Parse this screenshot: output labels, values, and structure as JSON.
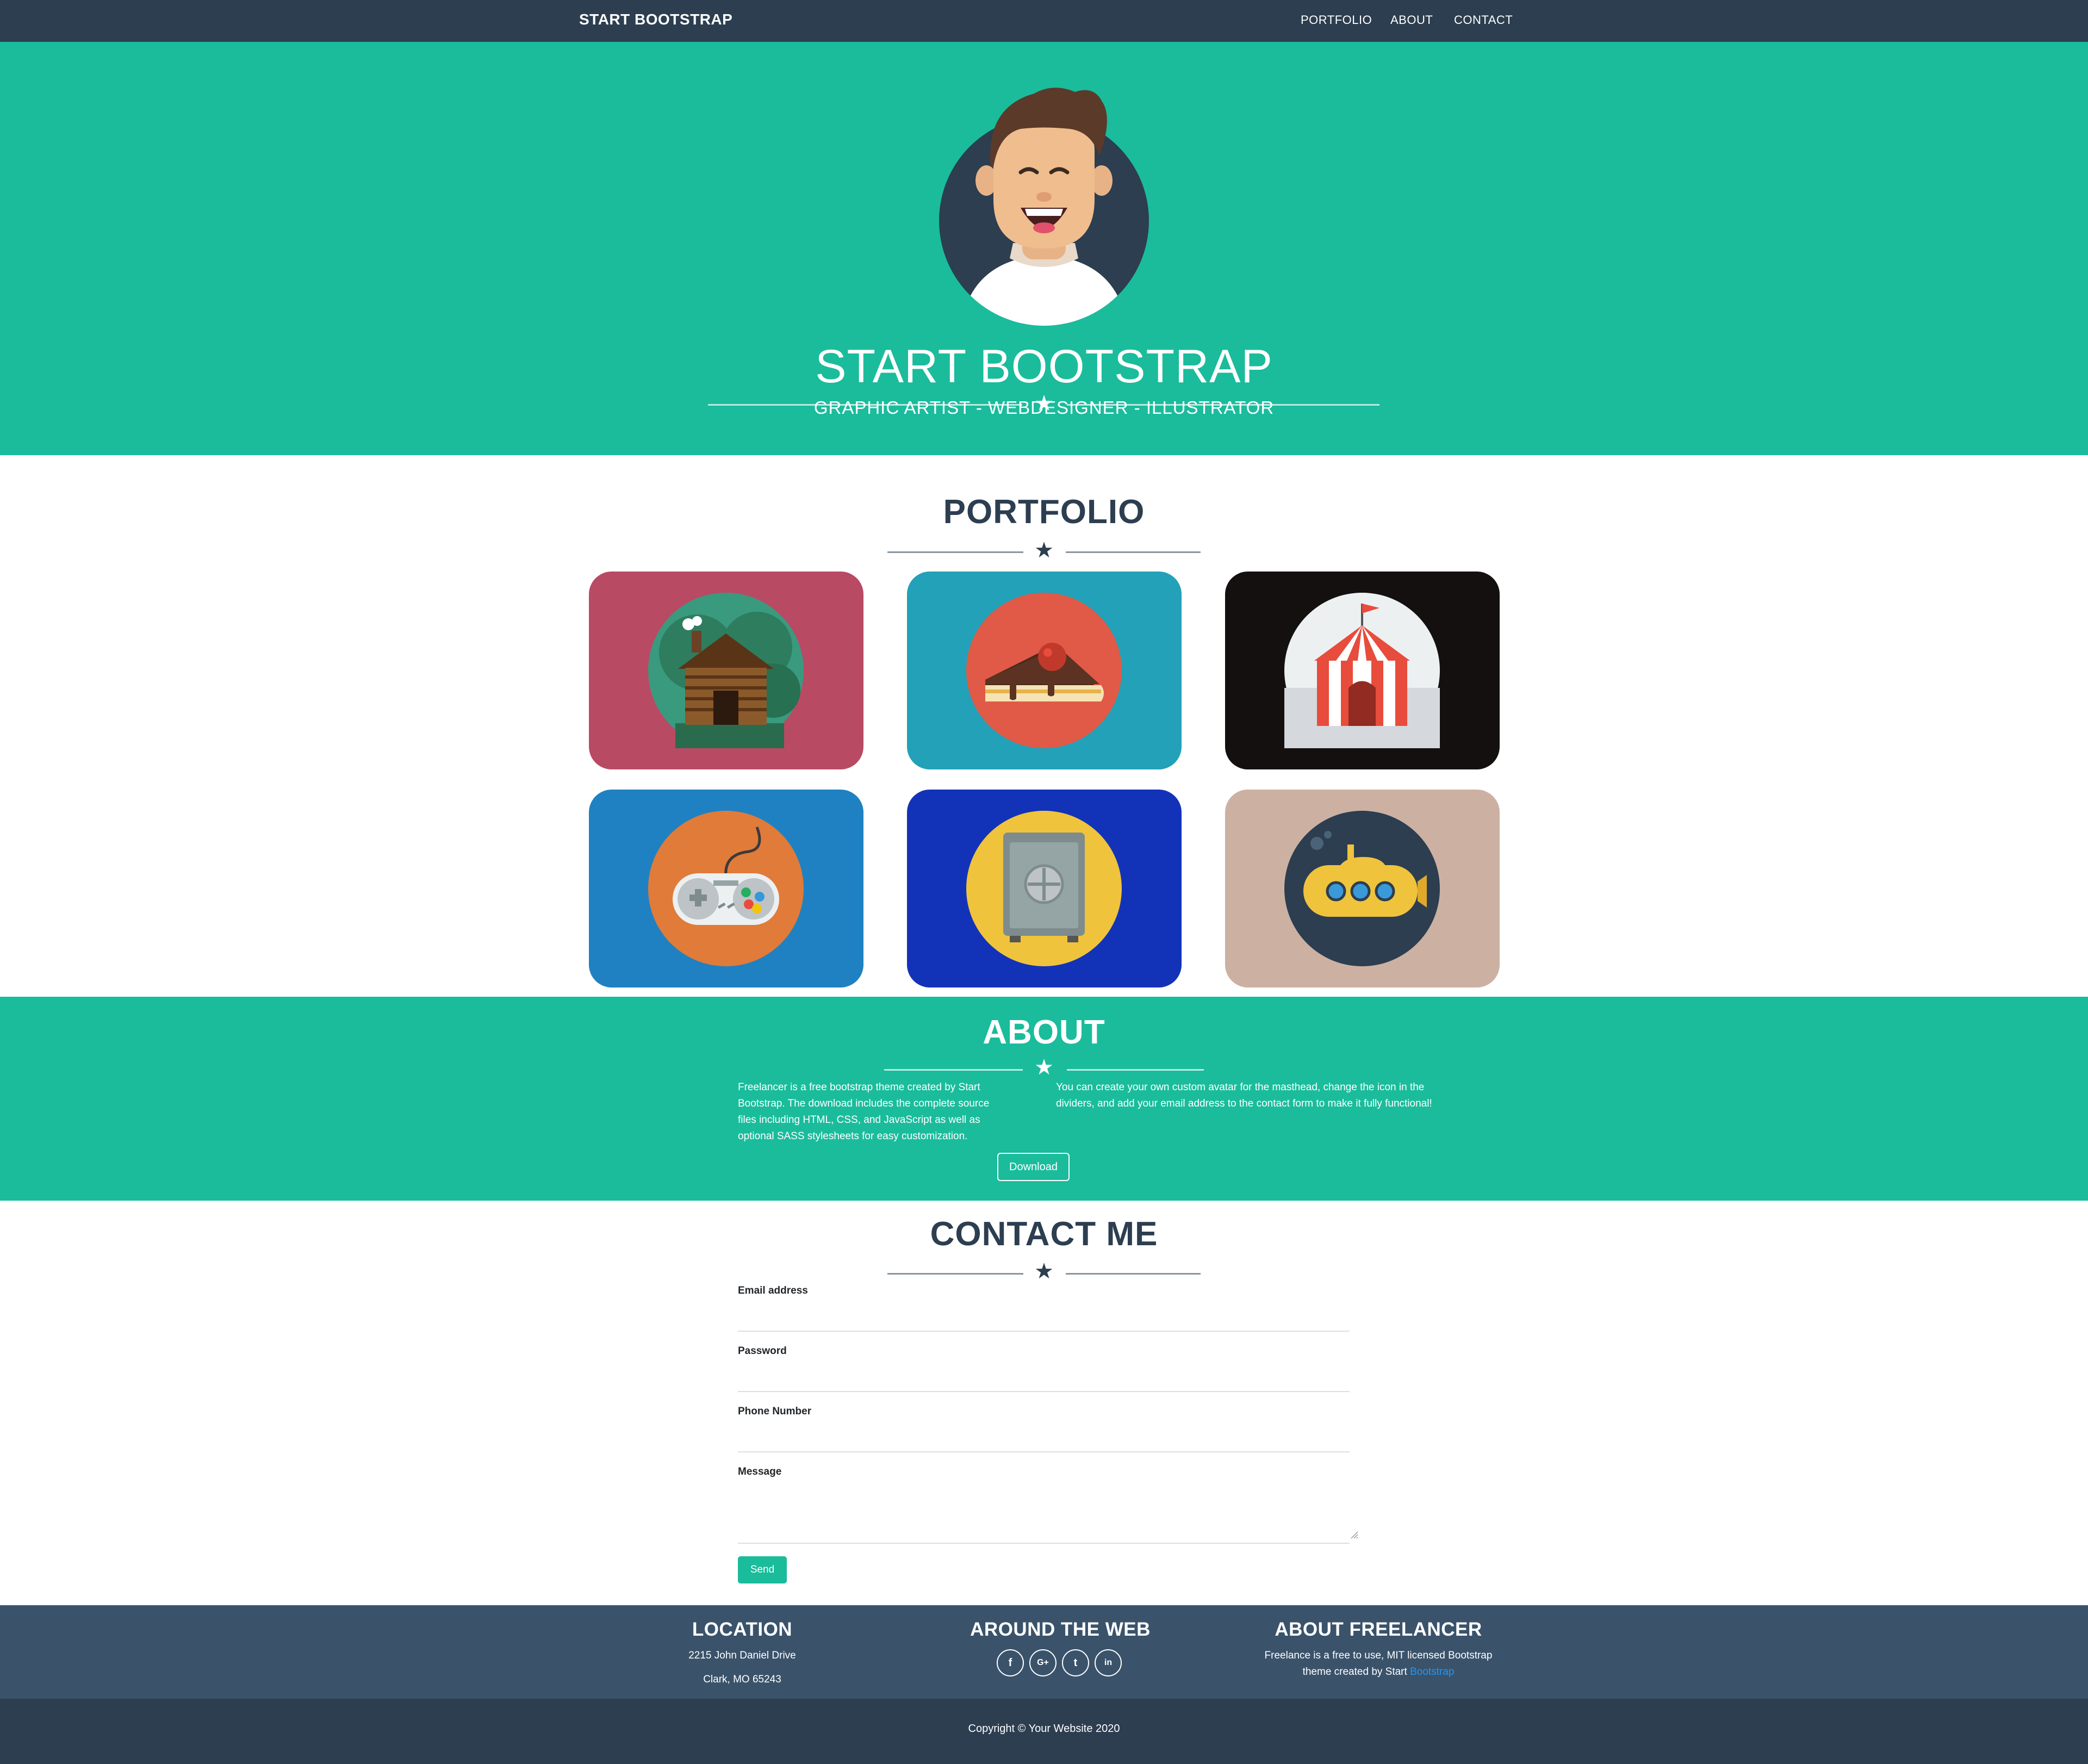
{
  "navbar": {
    "brand": "START BOOTSTRAP",
    "links": [
      "PORTFOLIO",
      "ABOUT",
      "CONTACT"
    ]
  },
  "masthead": {
    "title": "START BOOTSTRAP",
    "subtitle": "GRAPHIC ARTIST - WEBDESIGNER - ILLUSTRATOR",
    "avatar_icon": "cartoon-avatar"
  },
  "portfolio": {
    "title": "PORTFOLIO",
    "items": [
      {
        "icon": "cabin-icon",
        "bg": "#b94a64"
      },
      {
        "icon": "cake-icon",
        "bg": "#22a1b8"
      },
      {
        "icon": "circus-tent-icon",
        "bg": "#141010"
      },
      {
        "icon": "game-controller-icon",
        "bg": "#1f81c2"
      },
      {
        "icon": "safe-icon",
        "bg": "#1233b8"
      },
      {
        "icon": "submarine-icon",
        "bg": "#ccb1a3"
      }
    ]
  },
  "about": {
    "title": "ABOUT",
    "left_text": [
      "Freelancer is a free bootstrap theme created by Start",
      "Bootstrap. The download includes the complete source",
      "files including HTML, CSS, and JavaScript as well as",
      "optional SASS stylesheets for easy customization."
    ],
    "right_text": [
      "You can create your own custom avatar for the masthead, change the icon in the",
      "dividers, and add your email address to the contact form to make it fully functional!"
    ],
    "download_label": "Download"
  },
  "contact": {
    "title": "CONTACT ME",
    "fields": [
      {
        "label": "Email address",
        "value": ""
      },
      {
        "label": "Password",
        "value": ""
      },
      {
        "label": "Phone Number",
        "value": ""
      },
      {
        "label": "Message",
        "value": ""
      }
    ],
    "send_label": "Send"
  },
  "footer": {
    "location": {
      "title": "LOCATION",
      "line1": "2215 John Daniel Drive",
      "line2": "Clark, MO 65243"
    },
    "web": {
      "title": "AROUND THE WEB",
      "icons": [
        {
          "name": "facebook-icon",
          "glyph": "f"
        },
        {
          "name": "google-plus-icon",
          "glyph": "G+"
        },
        {
          "name": "twitter-icon",
          "glyph": "t"
        },
        {
          "name": "linkedin-icon",
          "glyph": "in"
        }
      ]
    },
    "about": {
      "title": "ABOUT FREELANCER",
      "line1": "Freelance is a free to use, MIT licensed Bootstrap",
      "line2_prefix": "theme created by Start ",
      "link": "Bootstrap"
    }
  },
  "copyright": "Copyright © Your Website 2020",
  "colors": {
    "primary": "#1abc9c",
    "dark": "#2c3e50",
    "footer": "#3a536b",
    "link": "#2196f3"
  }
}
